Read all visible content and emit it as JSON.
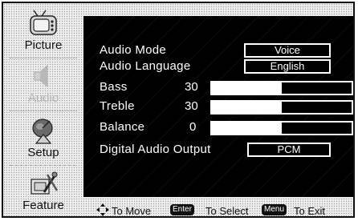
{
  "sidebar": {
    "items": [
      {
        "label": "Picture",
        "icon": "tv-icon"
      },
      {
        "label": "Audio",
        "icon": "speaker-icon"
      },
      {
        "label": "Setup",
        "icon": "satellite-dish-icon"
      },
      {
        "label": "Feature",
        "icon": "tools-icon"
      }
    ]
  },
  "audio_menu": {
    "audio_mode": {
      "label": "Audio Mode",
      "value": "Voice"
    },
    "audio_language": {
      "label": "Audio Language",
      "value": "English"
    },
    "bass": {
      "label": "Bass",
      "value": "30",
      "level": 0.5
    },
    "treble": {
      "label": "Treble",
      "value": "30",
      "level": 0.5
    },
    "balance": {
      "label": "Balance",
      "value": "0",
      "level": 0.5
    },
    "digital_audio_output": {
      "label": "Digital Audio Output",
      "value": "PCM"
    }
  },
  "footer": {
    "move": "To Move",
    "enter_key": "Enter",
    "select": "To Select",
    "menu_key": "Menu",
    "exit": "To Exit"
  }
}
